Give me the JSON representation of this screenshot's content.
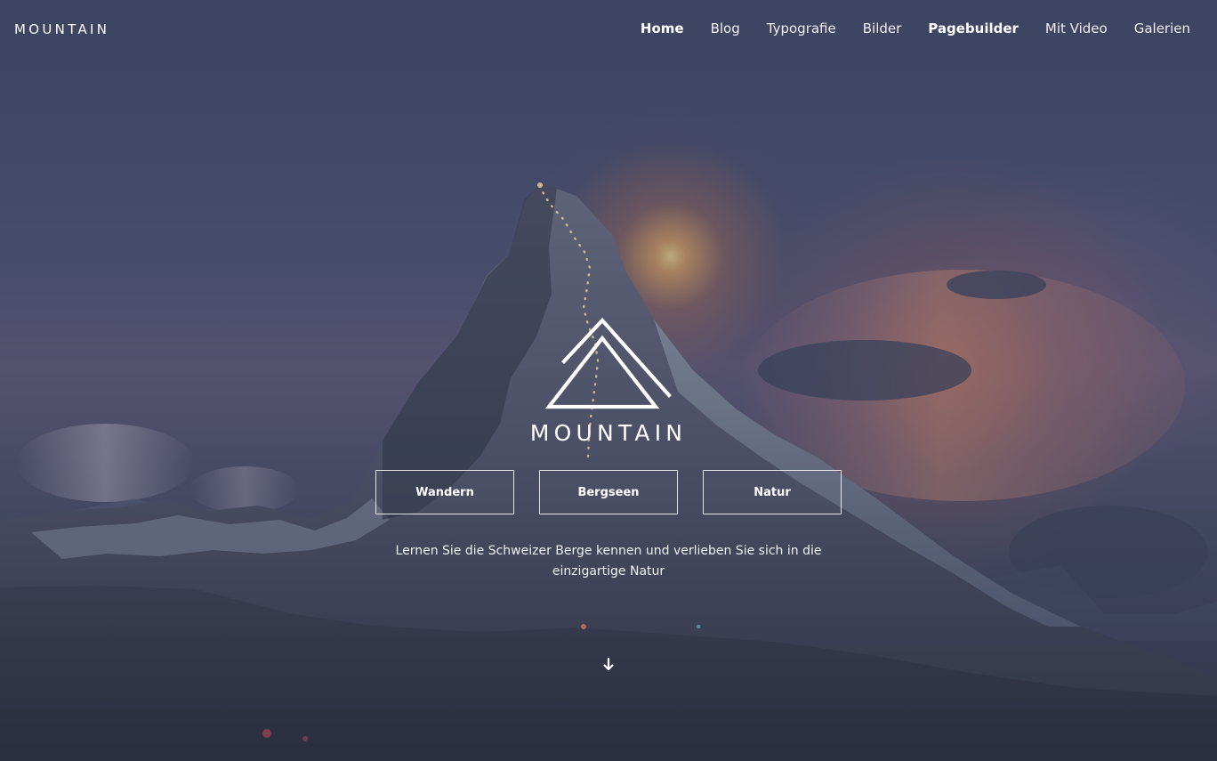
{
  "header": {
    "brand": "MOUNTAIN",
    "nav": [
      {
        "label": "Home",
        "bold": true
      },
      {
        "label": "Blog",
        "bold": false
      },
      {
        "label": "Typografie",
        "bold": false
      },
      {
        "label": "Bilder",
        "bold": false
      },
      {
        "label": "Pagebuilder",
        "bold": true
      },
      {
        "label": "Mit Video",
        "bold": false
      },
      {
        "label": "Galerien",
        "bold": false
      }
    ]
  },
  "hero": {
    "logo_text": "MOUNTAIN",
    "buttons": [
      {
        "label": "Wandern"
      },
      {
        "label": "Bergseen"
      },
      {
        "label": "Natur"
      }
    ],
    "tagline": "Lernen Sie die Schweizer Berge kennen und verlieben Sie sich in die einzigartige Natur",
    "scroll_icon": "arrow-down-icon"
  },
  "colors": {
    "text": "#ffffff",
    "overlay": "#262c44"
  }
}
